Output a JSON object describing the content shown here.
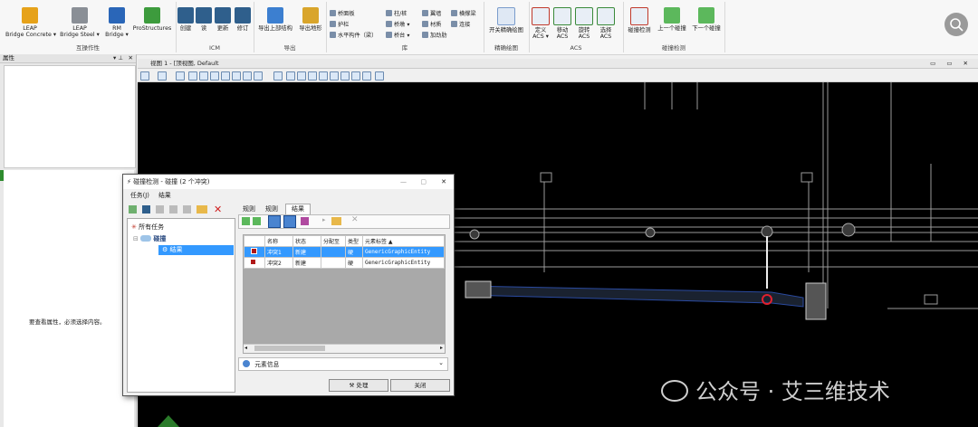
{
  "ribbon": {
    "groups": {
      "interop": {
        "label": "互操作性",
        "buttons": [
          {
            "label": "LEAP\nBridge Concrete ▾",
            "icon": "leap-concrete-icon"
          },
          {
            "label": "LEAP\nBridge Steel ▾",
            "icon": "leap-steel-icon"
          },
          {
            "label": "RM\nBridge ▾",
            "icon": "rm-bridge-icon"
          },
          {
            "label": "ProStructures",
            "icon": "prostructures-icon"
          }
        ]
      },
      "icm": {
        "label": "ICM",
        "buttons": [
          {
            "label": "创建",
            "icon": "create-icon"
          },
          {
            "label": "读",
            "icon": "read-icon"
          },
          {
            "label": "更新",
            "icon": "update-icon"
          },
          {
            "label": "修订",
            "icon": "revise-icon"
          }
        ]
      },
      "export": {
        "label": "导出",
        "buttons": [
          {
            "label": "导出上部结构",
            "icon": "export-superstructure-icon"
          },
          {
            "label": "导出地形",
            "icon": "export-terrain-icon"
          }
        ]
      },
      "library": {
        "label": "库",
        "items": [
          "桥面板",
          "柱/桩",
          "翼墙",
          "横撑梁",
          "护栏",
          "桥墩 ▾",
          "材质",
          "连接",
          "水平构件（梁）",
          "桥台 ▾",
          "加劲肋"
        ]
      },
      "bbox": {
        "label": "精确绘图",
        "buttons": [
          {
            "label": "开关精确绘图",
            "icon": "accudraw-icon"
          }
        ]
      },
      "acs": {
        "label": "ACS",
        "buttons": [
          {
            "label": "定义\nACS ▾",
            "icon": "define-acs-icon"
          },
          {
            "label": "移动\nACS",
            "icon": "move-acs-icon"
          },
          {
            "label": "旋转\nACS",
            "icon": "rotate-acs-icon"
          },
          {
            "label": "选择\nACS",
            "icon": "select-acs-icon"
          }
        ]
      },
      "clash": {
        "label": "碰撞检测",
        "buttons": [
          {
            "label": "碰撞检测",
            "icon": "clash-detection-icon"
          },
          {
            "label": "上一个碰撞",
            "icon": "prev-clash-icon"
          },
          {
            "label": "下一个碰撞",
            "icon": "next-clash-icon"
          }
        ]
      }
    }
  },
  "left_panel": {
    "title": "属性",
    "hint": "要查看属性，必须选择内容。"
  },
  "viewport": {
    "title": "视图 1 - [顶视图, Default"
  },
  "dialog": {
    "title": "碰撞检测 - 碰撞 (2 个冲突)",
    "menu": [
      "任务(J)",
      "结果"
    ],
    "tree": {
      "root": "所有任务",
      "job": "碰撞",
      "result": "结果"
    },
    "tabs": [
      "规则",
      "规则",
      "结果"
    ],
    "table": {
      "headers": [
        "",
        "名称",
        "状态",
        "分配至",
        "类型",
        "元素标签 ▲"
      ],
      "rows": [
        {
          "name": "冲突1",
          "status": "新建",
          "assigned": "",
          "type": "硬",
          "tag": "GenericGraphicEntity"
        },
        {
          "name": "冲突2",
          "status": "新建",
          "assigned": "",
          "type": "硬",
          "tag": "GenericGraphicEntity"
        }
      ]
    },
    "element_info": "元素信息",
    "buttons": {
      "process": "处理",
      "close": "关闭"
    }
  },
  "watermark": "公众号 · 艾三维技术",
  "colors": {
    "accent": "#2a66b8",
    "clash_red": "#e0202e",
    "selection": "#3399ff"
  }
}
